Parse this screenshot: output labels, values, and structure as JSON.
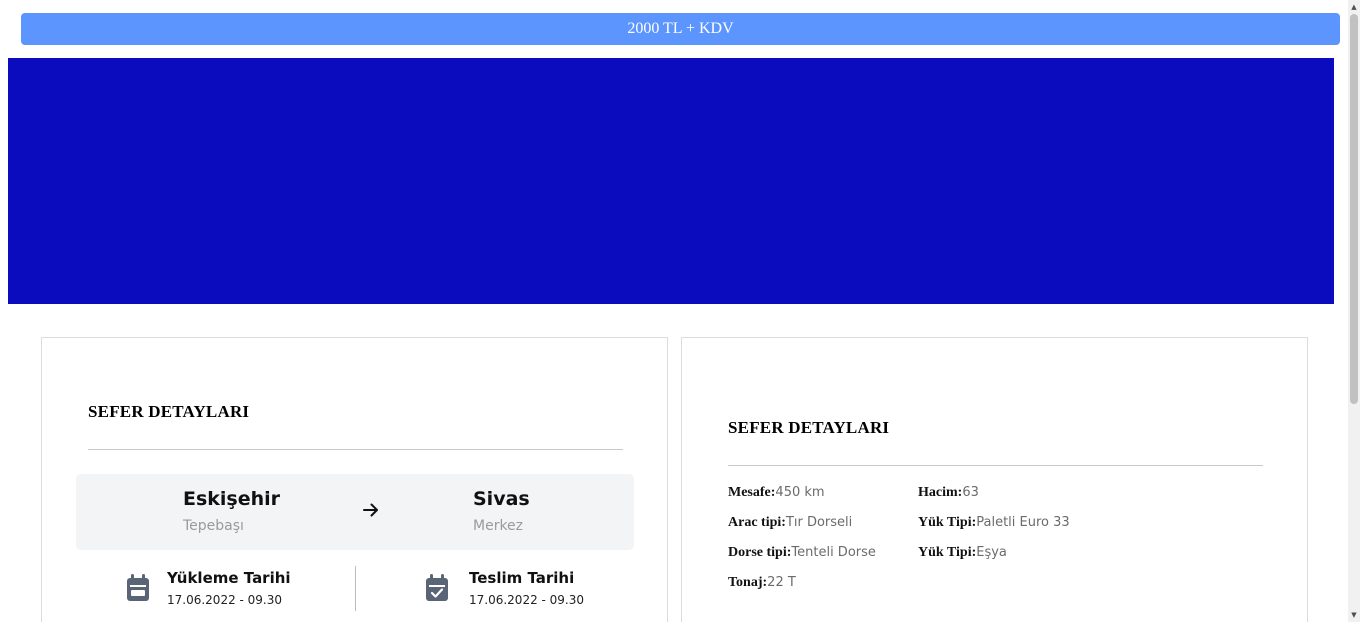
{
  "price_bar": {
    "label": "2000 TL + KDV"
  },
  "colors": {
    "price_bar": "#5c95fd",
    "hero": "#0c0cbf",
    "route_box": "#f3f4f6",
    "icon": "#5a6477"
  },
  "left_card": {
    "title": "SEFER DETAYLARI",
    "route": {
      "from_city": "Eskişehir",
      "from_district": "Tepebaşı",
      "to_city": "Sivas",
      "to_district": "Merkez",
      "arrow_icon": "arrow-right-icon"
    },
    "loading": {
      "label": "Yükleme Tarihi",
      "value": "17.06.2022 - 09.30",
      "icon": "calendar-icon"
    },
    "delivery": {
      "label": "Teslim Tarihi",
      "value": "17.06.2022 - 09.30",
      "icon": "calendar-check-icon"
    }
  },
  "right_card": {
    "title": "SEFER DETAYLARI",
    "details": [
      {
        "key": "Mesafe:",
        "value": "450 km"
      },
      {
        "key": "Hacim:",
        "value": "63"
      },
      {
        "key": "Arac tipi:",
        "value": "Tır Dorseli"
      },
      {
        "key": "Yük Tipi:",
        "value": "Paletli Euro 33"
      },
      {
        "key": "Dorse tipi:",
        "value": "Tenteli Dorse"
      },
      {
        "key": "Yük Tipi:",
        "value": "Eşya"
      },
      {
        "key": "Tonaj:",
        "value": "22 T"
      }
    ]
  }
}
